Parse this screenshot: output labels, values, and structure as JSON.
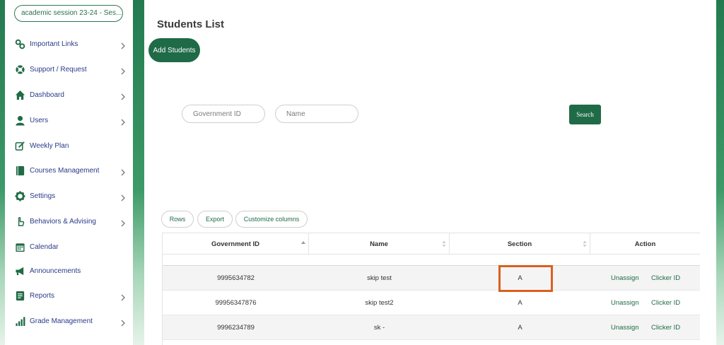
{
  "sidebar": {
    "session": "academic session 23-24 - Ses...",
    "items": [
      {
        "label": "Important Links",
        "icon": "link-icon",
        "chevron": true
      },
      {
        "label": "Support / Request",
        "icon": "lifebuoy-icon",
        "chevron": true
      },
      {
        "label": "Dashboard",
        "icon": "home-icon",
        "chevron": true
      },
      {
        "label": "Users",
        "icon": "user-icon",
        "chevron": true
      },
      {
        "label": "Weekly Plan",
        "icon": "edit-icon",
        "chevron": false
      },
      {
        "label": "Courses Management",
        "icon": "book-icon",
        "chevron": true
      },
      {
        "label": "Settings",
        "icon": "gear-icon",
        "chevron": true
      },
      {
        "label": "Behaviors & Advising",
        "icon": "hand-icon",
        "chevron": true
      },
      {
        "label": "Calendar",
        "icon": "calendar-icon",
        "chevron": false
      },
      {
        "label": "Announcements",
        "icon": "megaphone-icon",
        "chevron": false
      },
      {
        "label": "Reports",
        "icon": "report-icon",
        "chevron": true
      },
      {
        "label": "Grade Management",
        "icon": "bar-chart-icon",
        "chevron": true
      }
    ]
  },
  "main": {
    "title": "Students List",
    "add_button": "Add Students",
    "filters": {
      "government_id_placeholder": "Government ID",
      "name_placeholder": "Name",
      "search_button": "Search"
    },
    "toolbar": {
      "rows": "Rows",
      "export": "Export",
      "customize": "Customize columns"
    },
    "table": {
      "headers": [
        "Government ID",
        "Name",
        "Section",
        "Action"
      ],
      "rows": [
        {
          "gov_id": "9995634782",
          "name": "skip test",
          "section": "A",
          "unassign": "Unassign",
          "clicker": "Clicker ID"
        },
        {
          "gov_id": "99956347876",
          "name": "skip test2",
          "section": "A",
          "unassign": "Unassign",
          "clicker": "Clicker ID"
        },
        {
          "gov_id": "9996234789",
          "name": "sk -",
          "section": "A",
          "unassign": "Unassign",
          "clicker": "Clicker ID"
        }
      ]
    }
  },
  "colors": {
    "brand_green": "#1f6b47",
    "nav_text": "#2b3a88",
    "highlight": "#d9601f"
  }
}
